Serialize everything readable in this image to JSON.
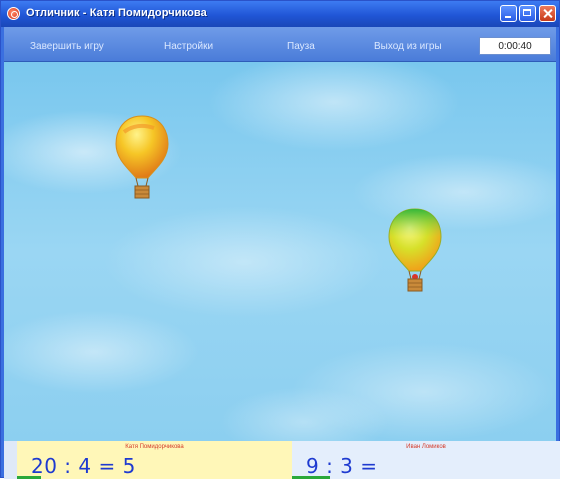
{
  "window": {
    "title": "Отличник - Катя Помидорчикова"
  },
  "menu": {
    "items": [
      {
        "label": "Завершить игру"
      },
      {
        "label": "Настройки"
      },
      {
        "label": "Пауза"
      },
      {
        "label": "Выход из игры"
      }
    ],
    "timer": "0:00:40"
  },
  "game": {
    "balloons": [
      {
        "color": "orange-yellow"
      },
      {
        "color": "green-yellow"
      }
    ]
  },
  "players": [
    {
      "name": "Катя Помидорчикова",
      "expression": "20 : 4 = 5"
    },
    {
      "name": "Иван Ломиков",
      "expression": "9 : 3 ="
    }
  ],
  "colors": {
    "titlebar": "#2056d6",
    "menubar": "#5a89dd",
    "sky": "#8ccff0",
    "expression": "#1e3ad0",
    "player_name": "#d43b2a",
    "progress": "#2aa83a"
  }
}
